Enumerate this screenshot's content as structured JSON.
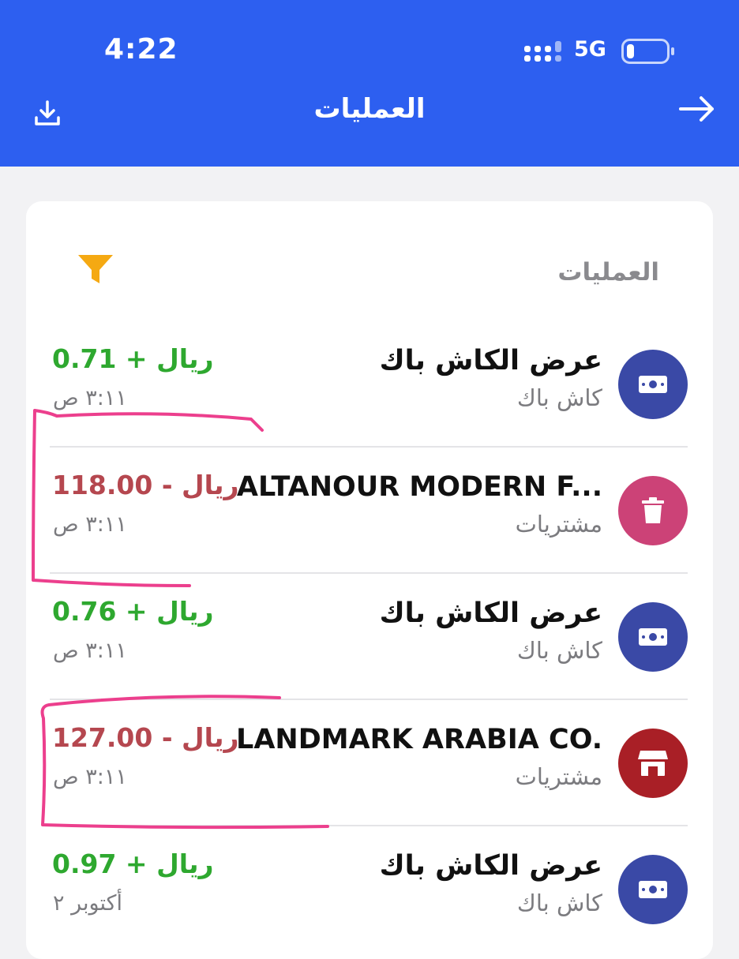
{
  "status_bar": {
    "time": "4:22",
    "network": "5G"
  },
  "header": {
    "title": "العمليات"
  },
  "card": {
    "title": "العمليات"
  },
  "colors": {
    "header_blue": "#2d5ff0",
    "positive": "#2ea82f",
    "negative": "#b5474f",
    "filter": "#f5a912",
    "cashback_icon_bg": "#3a49a6",
    "trash_icon_bg": "#cc4277",
    "store_icon_bg": "#a91f26",
    "annotation": "#ec3f8d"
  },
  "transactions": [
    {
      "name": "عرض الكاش باك",
      "category": "كاش باك",
      "amount": "0.71",
      "sign": "+",
      "currency": "ريال",
      "time": "٣:١١ ص",
      "icon": "cash-icon"
    },
    {
      "name": "ALTANOUR MODERN F...",
      "category": "مشتريات",
      "amount": "118.00",
      "sign": "-",
      "currency": "ريال",
      "time": "٣:١١ ص",
      "icon": "trash-icon"
    },
    {
      "name": "عرض الكاش باك",
      "category": "كاش باك",
      "amount": "0.76",
      "sign": "+",
      "currency": "ريال",
      "time": "٣:١١ ص",
      "icon": "cash-icon"
    },
    {
      "name": "LANDMARK ARABIA CO.",
      "category": "مشتريات",
      "amount": "127.00",
      "sign": "-",
      "currency": "ريال",
      "time": "٣:١١ ص",
      "icon": "store-icon"
    },
    {
      "name": "عرض الكاش باك",
      "category": "كاش باك",
      "amount": "0.97",
      "sign": "+",
      "currency": "ريال",
      "time": "أكتوبر ٢",
      "icon": "cash-icon"
    }
  ]
}
